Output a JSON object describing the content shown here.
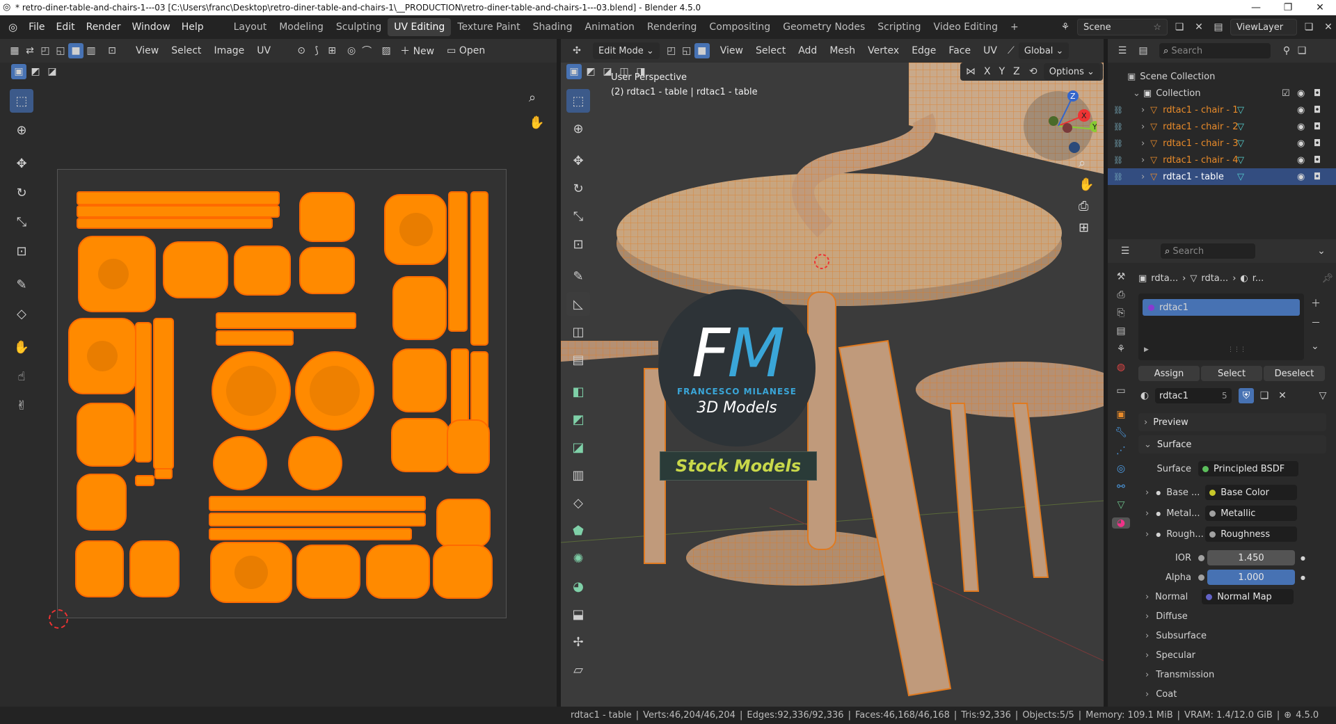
{
  "window": {
    "title": "* retro-diner-table-and-chairs-1---03 [C:\\Users\\franc\\Desktop\\retro-diner-table-and-chairs-1\\__PRODUCTION\\retro-diner-table-and-chairs-1---03.blend] - Blender 4.5.0"
  },
  "menu": [
    "File",
    "Edit",
    "Render",
    "Window",
    "Help"
  ],
  "workspaces": [
    "Layout",
    "Modeling",
    "Sculpting",
    "UV Editing",
    "Texture Paint",
    "Shading",
    "Animation",
    "Rendering",
    "Compositing",
    "Geometry Nodes",
    "Scripting",
    "Video Editing"
  ],
  "active_workspace": "UV Editing",
  "scene": {
    "name": "Scene",
    "view_layer": "ViewLayer"
  },
  "uv_editor": {
    "menus": [
      "View",
      "Select",
      "Image",
      "UV"
    ],
    "new_label": "New",
    "open_label": "Open"
  },
  "viewport": {
    "mode": "Edit Mode",
    "menus": [
      "View",
      "Select",
      "Add",
      "Mesh",
      "Vertex",
      "Edge",
      "Face",
      "UV"
    ],
    "orientation": "Global",
    "options_label": "Options",
    "axes": [
      "X",
      "Y",
      "Z"
    ],
    "overlay_line1": "User Perspective",
    "overlay_line2": "(2) rdtac1 - table | rdtac1 - table",
    "logo_letters": "FM",
    "logo_name": "FRANCESCO MILANESE",
    "logo_sub": "3D Models",
    "logo_banner": "Stock Models"
  },
  "outliner": {
    "search_placeholder": "Search",
    "root": "Scene Collection",
    "collection": "Collection",
    "items": [
      {
        "name": "rdtac1 - chair - 1",
        "selected": false
      },
      {
        "name": "rdtac1 - chair - 2",
        "selected": false
      },
      {
        "name": "rdtac1 - chair - 3",
        "selected": false
      },
      {
        "name": "rdtac1 - chair - 4",
        "selected": false
      },
      {
        "name": "rdtac1 - table",
        "selected": true
      }
    ]
  },
  "properties": {
    "search_placeholder": "Search",
    "breadcrumb": [
      "rdta...",
      "rdta...",
      "r..."
    ],
    "material_slot": "rdtac1",
    "buttons": {
      "assign": "Assign",
      "select": "Select",
      "deselect": "Deselect"
    },
    "material_name": "rdtac1",
    "user_count": "5",
    "panels": {
      "preview": "Preview",
      "surface": "Surface"
    },
    "surface_label": "Surface",
    "surface_value": "Principled BSDF",
    "inputs": [
      {
        "label": "Base ...",
        "value": "Base Color",
        "color": "#c7c729"
      },
      {
        "label": "Metal...",
        "value": "Metallic",
        "color": "#a1a1a1"
      },
      {
        "label": "Rough...",
        "value": "Roughness",
        "color": "#a1a1a1"
      }
    ],
    "ior": {
      "label": "IOR",
      "value": "1.450"
    },
    "alpha": {
      "label": "Alpha",
      "value": "1.000"
    },
    "normal": {
      "label": "Normal",
      "value": "Normal Map",
      "color": "#6363c7"
    },
    "subpanels": [
      "Diffuse",
      "Subsurface",
      "Specular",
      "Transmission",
      "Coat"
    ]
  },
  "status": {
    "object": "rdtac1 - table",
    "verts": "Verts:46,204/46,204",
    "edges": "Edges:92,336/92,336",
    "faces": "Faces:46,168/46,168",
    "tris": "Tris:92,336",
    "objects": "Objects:5/5",
    "memory": "Memory: 109.1 MiB",
    "vram": "VRAM: 1.4/12.0 GiB",
    "version": "4.5.0"
  },
  "colors": {
    "accent": "#4772b3",
    "uv_orange": "#ff8a00",
    "wire_orange": "#f09030"
  }
}
